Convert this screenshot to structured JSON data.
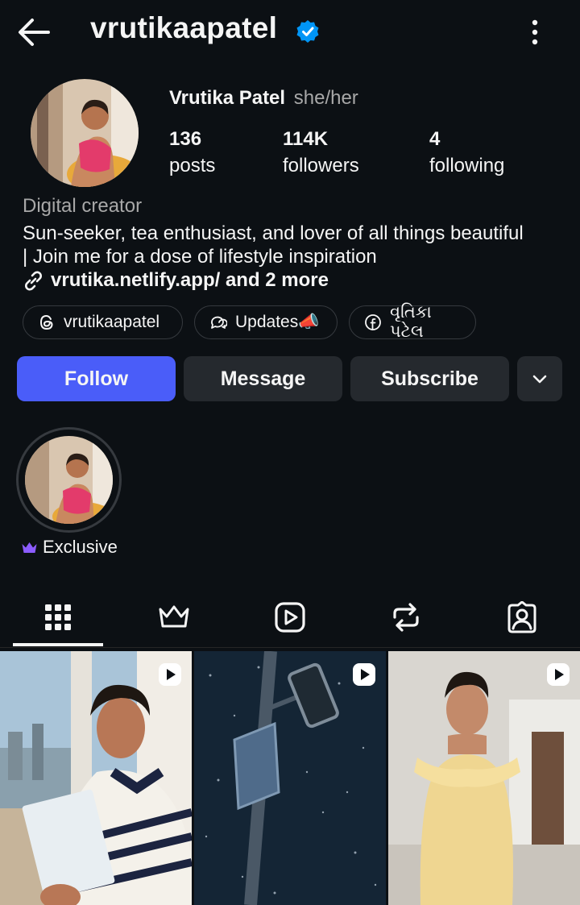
{
  "header": {
    "username": "vrutikaapatel",
    "back_icon": "arrow-left-icon",
    "verified_icon": "verified-badge-icon",
    "menu_icon": "more-vertical-icon"
  },
  "profile": {
    "full_name": "Vrutika Patel",
    "pronouns": "she/her",
    "avatar_icon": "profile-photo",
    "stats": {
      "posts": {
        "value": "136",
        "label": "posts"
      },
      "followers": {
        "value": "114K",
        "label": "followers"
      },
      "following": {
        "value": "4",
        "label": "following"
      }
    },
    "category": "Digital creator",
    "bio_line1": "Sun-seeker, tea enthusiast, and lover of all things beautiful",
    "bio_line2": "| Join me for a dose of lifestyle inspiration",
    "link_text": "vrutika.netlify.app/ and 2 more"
  },
  "chips": [
    {
      "label": "vrutikaapatel",
      "icon": "threads-icon"
    },
    {
      "label": "Updates📣",
      "icon": "broadcast-channel-icon"
    },
    {
      "label": "વૃતિકા પટેલ",
      "icon": "facebook-icon"
    }
  ],
  "actions": {
    "follow": "Follow",
    "message": "Message",
    "subscribe": "Subscribe",
    "more_icon": "chevron-down-icon"
  },
  "highlights": [
    {
      "label": "Exclusive",
      "icon": "crown-icon"
    }
  ],
  "tabs": [
    {
      "name": "posts-grid",
      "icon": "grid-icon",
      "selected": true
    },
    {
      "name": "subscriptions",
      "icon": "crown-icon",
      "selected": false
    },
    {
      "name": "reels",
      "icon": "reels-icon",
      "selected": false
    },
    {
      "name": "reposts",
      "icon": "repost-icon",
      "selected": false
    },
    {
      "name": "tagged",
      "icon": "tagged-user-icon",
      "selected": false
    }
  ],
  "grid": [
    {
      "type": "reel",
      "icon": "reel-play-icon"
    },
    {
      "type": "reel",
      "icon": "reel-play-icon"
    },
    {
      "type": "reel",
      "icon": "reel-play-icon"
    }
  ],
  "colors": {
    "background": "#0c1014",
    "primary_button": "#4a5df9",
    "secondary_button": "#25292e",
    "verified": "#0095f6",
    "crown": "#8c5cff"
  }
}
